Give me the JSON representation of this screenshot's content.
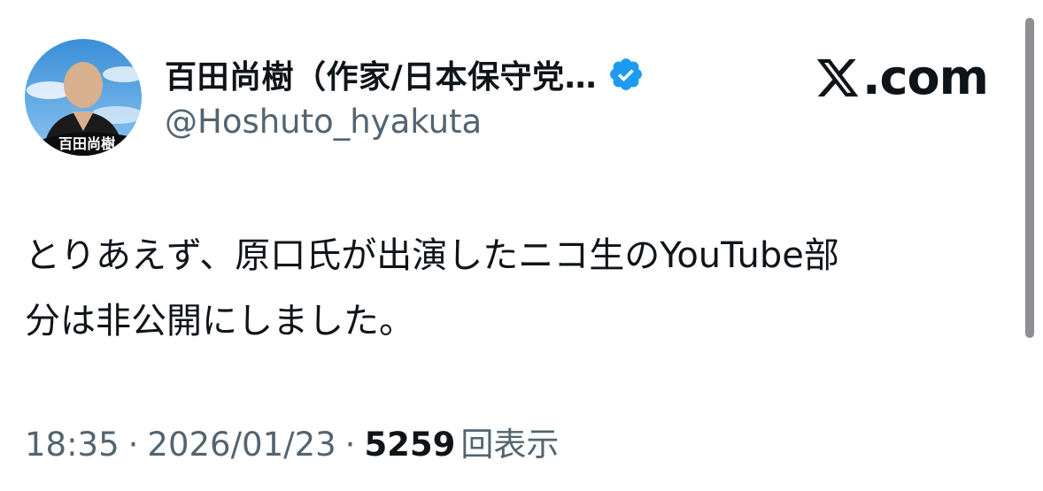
{
  "author": {
    "display_name": "百田尚樹（作家/日本保守党…",
    "handle": "@Hoshuto_hyakuta",
    "avatar_signature": "百田尚樹",
    "verified_color": "#1d9bf0"
  },
  "brand": {
    "domain": ".com"
  },
  "tweet": {
    "lines": [
      "とりあえず、原口氏が出演したニコ生のYouTube部",
      "分は非公開にしました。"
    ]
  },
  "meta": {
    "time": "18:35",
    "separator": "·",
    "date": "2026/01/23",
    "views_count": "5259",
    "views_label": "回表示"
  },
  "colors": {
    "text_primary": "#0f1419",
    "text_secondary": "#536471",
    "verified": "#1d9bf0"
  }
}
